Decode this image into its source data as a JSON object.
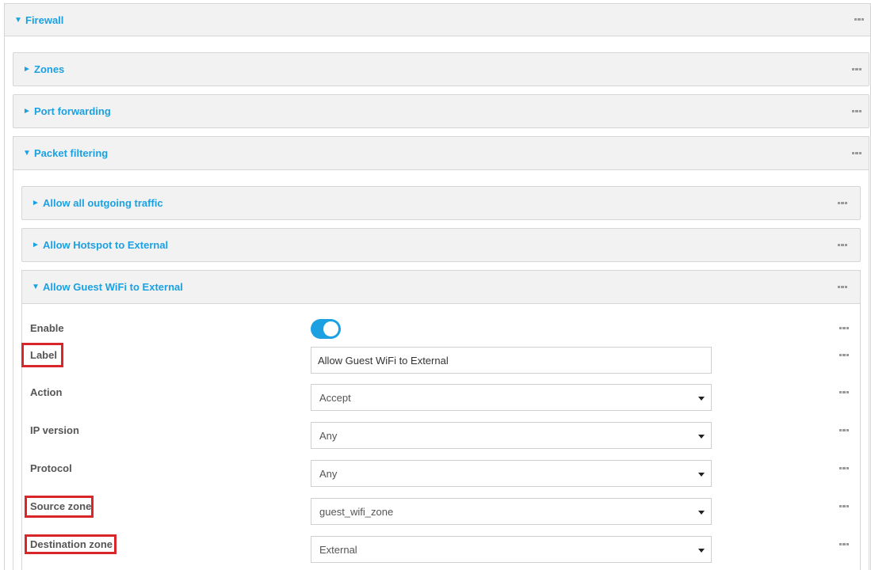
{
  "firewall": {
    "title": "Firewall",
    "arrow": "▼"
  },
  "sections": {
    "zones": {
      "title": "Zones",
      "arrow": "►"
    },
    "port_forwarding": {
      "title": "Port forwarding",
      "arrow": "►"
    },
    "packet_filtering": {
      "title": "Packet filtering",
      "arrow": "▼"
    }
  },
  "rules": {
    "allow_outgoing": {
      "title": "Allow all outgoing traffic",
      "arrow": "►"
    },
    "allow_hotspot": {
      "title": "Allow Hotspot to External",
      "arrow": "►"
    },
    "allow_guest": {
      "title": "Allow Guest WiFi to External",
      "arrow": "▼"
    }
  },
  "form": {
    "enable": {
      "label": "Enable",
      "value": true
    },
    "label": {
      "label": "Label",
      "value": "Allow Guest WiFi to External"
    },
    "action": {
      "label": "Action",
      "value": "Accept"
    },
    "ip_version": {
      "label": "IP version",
      "value": "Any"
    },
    "protocol": {
      "label": "Protocol",
      "value": "Any"
    },
    "source_zone": {
      "label": "Source zone",
      "value": "guest_wifi_zone"
    },
    "destination_zone": {
      "label": "Destination zone",
      "value": "External"
    }
  },
  "colors": {
    "accent": "#1ba1e2",
    "highlight": "#d9262b",
    "header_bg": "#f2f2f2"
  }
}
